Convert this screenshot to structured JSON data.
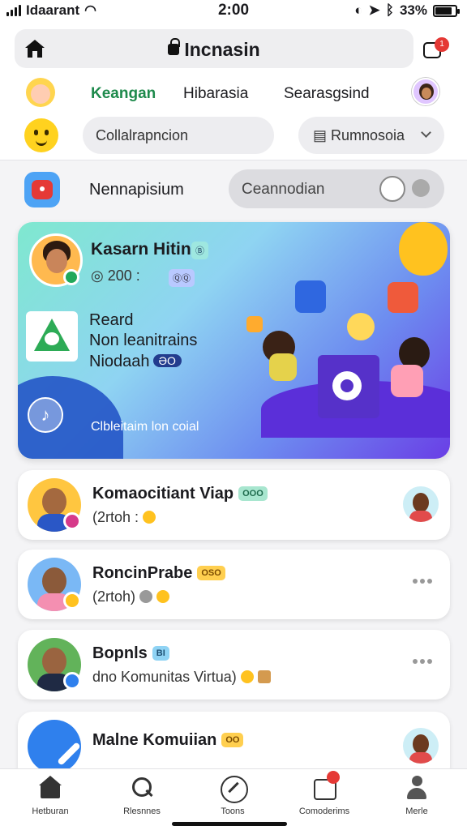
{
  "status_bar": {
    "carrier": "Idaarant",
    "time": "2:00",
    "battery": "33%",
    "battery_level": 0.85
  },
  "header": {
    "title": "Incnasin",
    "notification_badge": "1"
  },
  "tabs": [
    {
      "label": "Keangan",
      "active": true
    },
    {
      "label": "Hibarasia",
      "active": false
    },
    {
      "label": "Searasgsind",
      "active": false
    }
  ],
  "filters": {
    "search_placeholder": "Collalrapncion",
    "select_value": "Rumnosoia",
    "select_icon": "calendar-icon"
  },
  "sub_row": {
    "label": "Nennapisium",
    "pill_text": "Ceannodian"
  },
  "hero": {
    "name": "Kasarn Hitin",
    "name_tag": "Ⓑ",
    "meta": "200 :",
    "meta_tag": "ⓆⓆ",
    "lines": [
      "Reard",
      "Non leanitrains",
      "Niodaah"
    ],
    "line3_badge": "ƏO",
    "caption": "Clbleitaim lon coial"
  },
  "cards": [
    {
      "name": "Komaocitiant Viap",
      "tag": "OOO",
      "tag_color": "#a8e6cf",
      "sub": "(2rtoh :",
      "right": "avatar"
    },
    {
      "name": "RoncinPrabe",
      "tag": "OSO",
      "tag_color": "#ffcf4f",
      "sub": "(2rtoh)",
      "right": "more"
    },
    {
      "name": "Bopnls",
      "tag": "BI",
      "tag_color": "#8fd3f4",
      "sub": "dno  Komunitas Virtua)",
      "right": "more"
    },
    {
      "name": "Malne Komuiian",
      "tag": "OO",
      "tag_color": "#ffcf4f",
      "sub": "",
      "right": "avatar"
    }
  ],
  "bottom_nav": [
    {
      "label": "Hetburan",
      "icon": "home-icon"
    },
    {
      "label": "Rlesnnes",
      "icon": "search-icon"
    },
    {
      "label": "Toons",
      "icon": "compass-icon"
    },
    {
      "label": "Comoderims",
      "icon": "community-icon"
    },
    {
      "label": "Merle",
      "icon": "user-icon"
    }
  ]
}
